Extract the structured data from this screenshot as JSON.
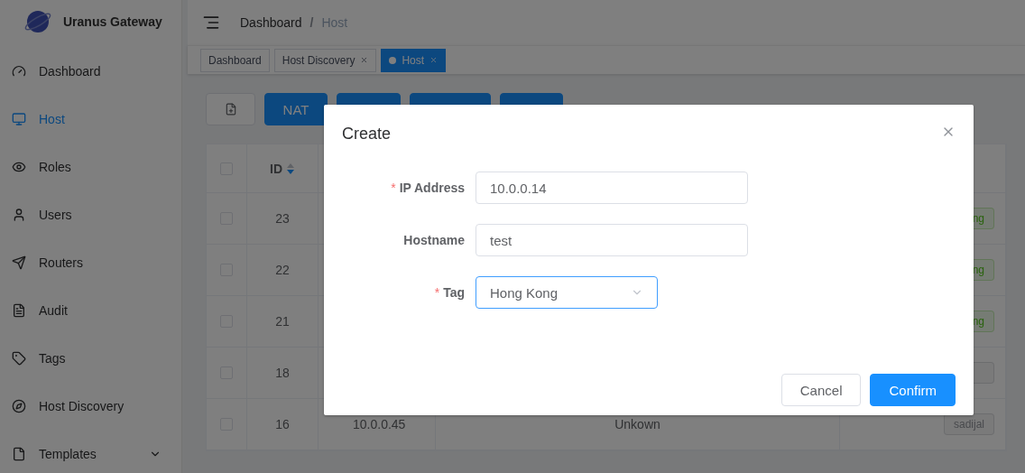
{
  "sidebar": {
    "logo_text": "Uranus Gateway",
    "items": [
      {
        "label": "Dashboard",
        "selected": false,
        "has_submenu": false
      },
      {
        "label": "Host",
        "selected": true,
        "has_submenu": false
      },
      {
        "label": "Roles",
        "selected": false,
        "has_submenu": false
      },
      {
        "label": "Users",
        "selected": false,
        "has_submenu": false
      },
      {
        "label": "Routers",
        "selected": false,
        "has_submenu": false
      },
      {
        "label": "Audit",
        "selected": false,
        "has_submenu": false
      },
      {
        "label": "Tags",
        "selected": false,
        "has_submenu": false
      },
      {
        "label": "Host Discovery",
        "selected": false,
        "has_submenu": false
      },
      {
        "label": "Templates",
        "selected": false,
        "has_submenu": true
      }
    ]
  },
  "header": {
    "breadcrumb": [
      "Dashboard",
      "Host"
    ],
    "separator": "/"
  },
  "tabs": [
    {
      "label": "Dashboard",
      "selected": false,
      "closable": false
    },
    {
      "label": "Host Discovery",
      "selected": false,
      "closable": true
    },
    {
      "label": "Host",
      "selected": true,
      "closable": true
    }
  ],
  "toolbar": {
    "buttons": [
      {
        "kind": "icon"
      },
      {
        "kind": "primary",
        "label": "NAT"
      },
      {
        "kind": "primary"
      },
      {
        "kind": "primary"
      },
      {
        "kind": "primary"
      }
    ]
  },
  "table": {
    "id_heading": "ID",
    "all_selected": false,
    "rows": [
      {
        "selected": false,
        "id": "23",
        "tag": {
          "text": "ng",
          "kind": "success"
        }
      },
      {
        "selected": false,
        "id": "22",
        "tag": {
          "text": "ng",
          "kind": "success"
        }
      },
      {
        "selected": false,
        "id": "21",
        "tag": {
          "text": "ng",
          "kind": "success"
        }
      },
      {
        "selected": false,
        "id": "18",
        "tag": {
          "kind": "info"
        }
      },
      {
        "selected": false,
        "id": "16",
        "ip": "10.0.0.45",
        "hostname": "Unkown",
        "tag": {
          "text": "sadijal",
          "kind": "info"
        }
      }
    ]
  },
  "modal": {
    "title": "Create",
    "required_mark": "*",
    "fields": [
      {
        "kind": "input",
        "label": "IP Address",
        "required": true,
        "value": "10.0.0.14",
        "focused": false
      },
      {
        "kind": "input",
        "label": "Hostname",
        "required": false,
        "value": "test",
        "focused": false
      },
      {
        "kind": "select",
        "label": "Tag",
        "required": true,
        "value": "Hong Kong",
        "focused": true
      }
    ],
    "buttons": [
      {
        "kind": "default",
        "label": "Cancel"
      },
      {
        "kind": "primary",
        "label": "Confirm"
      }
    ]
  }
}
